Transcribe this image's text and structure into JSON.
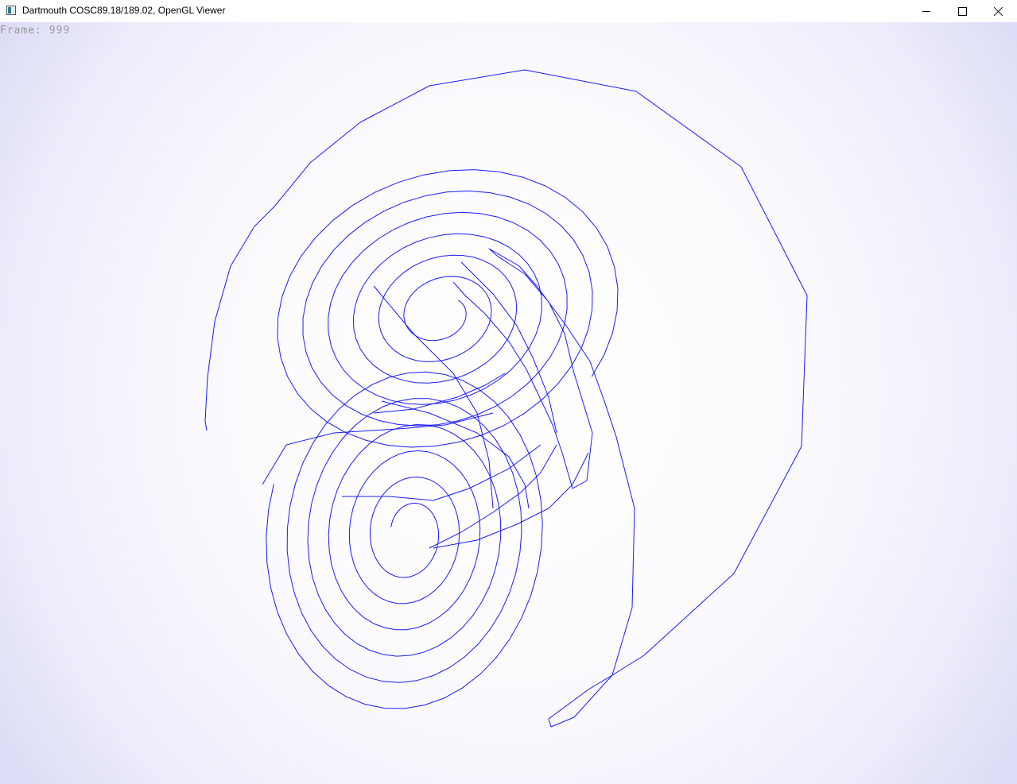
{
  "window": {
    "title": "Dartmouth COSC89.18/189.02, OpenGL Viewer",
    "controls": {
      "minimize_icon": "minimize-icon",
      "maximize_icon": "maximize-icon",
      "close_icon": "close-icon"
    }
  },
  "viewer": {
    "frame_label": "Frame: 999",
    "curve_color": "#1a1aff",
    "background_center": "#ffffff",
    "background_edge": "#dcdcf6"
  }
}
